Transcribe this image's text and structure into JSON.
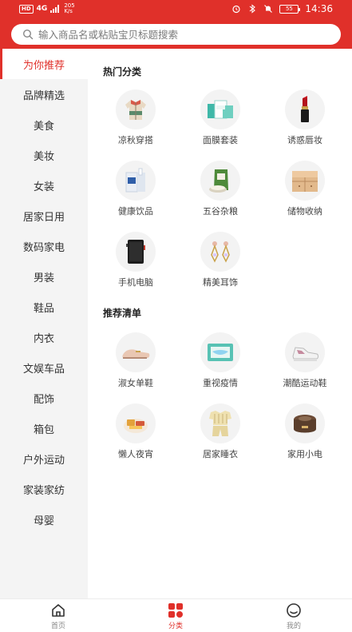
{
  "status_bar": {
    "hd_badge": "HD",
    "signal_text": "4G",
    "speed_value": "205",
    "speed_unit": "K/s",
    "battery": "55",
    "time": "14:36"
  },
  "search": {
    "placeholder": "输入商品名或粘贴宝贝标题搜索"
  },
  "sidebar": {
    "items": [
      {
        "label": "为你推荐",
        "active": true
      },
      {
        "label": "品牌精选"
      },
      {
        "label": "美食"
      },
      {
        "label": "美妆"
      },
      {
        "label": "女装"
      },
      {
        "label": "居家日用"
      },
      {
        "label": "数码家电"
      },
      {
        "label": "男装"
      },
      {
        "label": "鞋品"
      },
      {
        "label": "内衣"
      },
      {
        "label": "文娱车品"
      },
      {
        "label": "配饰"
      },
      {
        "label": "箱包"
      },
      {
        "label": "户外运动"
      },
      {
        "label": "家装家纺"
      },
      {
        "label": "母婴"
      }
    ]
  },
  "hot": {
    "title": "热门分类",
    "items": [
      {
        "label": "凉秋穿搭",
        "icon": "jacket-icon"
      },
      {
        "label": "面膜套装",
        "icon": "face-mask-box-icon"
      },
      {
        "label": "诱惑唇妆",
        "icon": "lipstick-icon"
      },
      {
        "label": "健康饮品",
        "icon": "milk-box-icon"
      },
      {
        "label": "五谷杂粮",
        "icon": "grain-bag-icon"
      },
      {
        "label": "储物收纳",
        "icon": "drawer-cabinet-icon"
      },
      {
        "label": "手机电脑",
        "icon": "phone-icon"
      },
      {
        "label": "精美耳饰",
        "icon": "earrings-icon"
      }
    ]
  },
  "recommend": {
    "title": "推荐清单",
    "items": [
      {
        "label": "淑女单鞋",
        "icon": "flat-shoe-icon"
      },
      {
        "label": "重视疫情",
        "icon": "medical-mask-icon"
      },
      {
        "label": "潮酷运动鞋",
        "icon": "sneaker-icon"
      },
      {
        "label": "懒人夜宵",
        "icon": "snack-icon"
      },
      {
        "label": "居家睡衣",
        "icon": "pajamas-icon"
      },
      {
        "label": "家用小电",
        "icon": "rice-cooker-icon"
      }
    ]
  },
  "tabbar": {
    "items": [
      {
        "label": "首页",
        "icon": "home-icon"
      },
      {
        "label": "分类",
        "icon": "category-icon",
        "active": true
      },
      {
        "label": "我的",
        "icon": "profile-icon"
      }
    ]
  },
  "colors": {
    "accent": "#e0302a",
    "sidebar_bg": "#f4f4f4"
  }
}
